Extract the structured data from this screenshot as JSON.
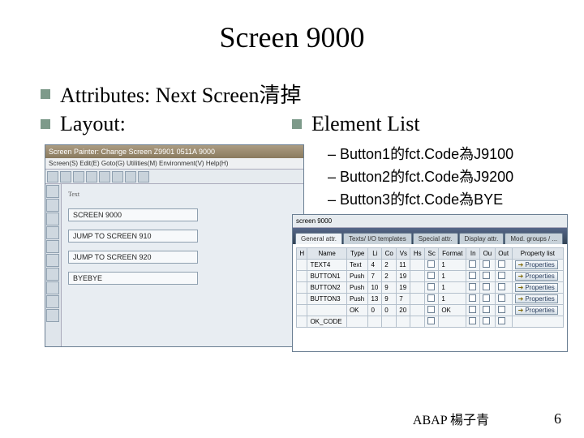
{
  "title": "Screen 9000",
  "bullets": {
    "b1": "Attributes: Next Screen清掉",
    "b2": "Layout:",
    "b3": "Element List"
  },
  "sublist": [
    "Button1的fct.Code為J9100",
    "Button2的fct.Code為J9200",
    "Button3的fct.Code為BYE"
  ],
  "shot1": {
    "titlebar": "Screen Painter: Change Screen Z9901 0511A 9000",
    "menu": "Screen(S)  Edit(E)  Goto(G)  Utilities(M)  Environment(V)  Help(H)",
    "canvas_label": "Text",
    "fields": [
      "SCREEN 9000",
      "JUMP TO SCREEN 910",
      "JUMP TO SCREEN 920",
      "BYEBYE"
    ]
  },
  "shot2": {
    "hdr": "screen                         9000",
    "tabs": [
      "General attr.",
      "Texts/ I/O templates",
      "Special attr.",
      "Display attr.",
      "Mod. groups / ..."
    ],
    "headers": [
      "H",
      "Name",
      "Type",
      "Li",
      "Co",
      "Vs",
      "Hs",
      "Sc",
      "Format",
      "In",
      "Ou",
      "Out",
      "Property list"
    ],
    "rows": [
      {
        "name": "TEXT4",
        "type": "Text",
        "li": "4",
        "co": "2",
        "vs": "11",
        "hs": "",
        "sc": "",
        "fmt": "1",
        "in": "",
        "ou": "",
        "out": "",
        "plist": "Properties"
      },
      {
        "name": "BUTTON1",
        "type": "Push",
        "li": "7",
        "co": "2",
        "vs": "19",
        "hs": "",
        "sc": "",
        "fmt": "1",
        "in": "",
        "ou": "",
        "out": "",
        "plist": "Properties"
      },
      {
        "name": "BUTTON2",
        "type": "Push",
        "li": "10",
        "co": "9",
        "vs": "19",
        "hs": "",
        "sc": "",
        "fmt": "1",
        "in": "",
        "ou": "",
        "out": "",
        "plist": "Properties"
      },
      {
        "name": "BUTTON3",
        "type": "Push",
        "li": "13",
        "co": "9",
        "vs": "7",
        "hs": "",
        "sc": "",
        "fmt": "1",
        "in": "",
        "ou": "",
        "out": "",
        "plist": "Properties"
      },
      {
        "name": "",
        "type": "OK",
        "li": "0",
        "co": "0",
        "vs": "20",
        "hs": "",
        "sc": "",
        "fmt": "OK",
        "in": "",
        "ou": "",
        "out": "",
        "plist": "Properties"
      },
      {
        "name": "OK_CODE",
        "type": "",
        "li": "",
        "co": "",
        "vs": "",
        "hs": "",
        "sc": "",
        "fmt": "",
        "in": "",
        "ou": "",
        "out": "",
        "plist": ""
      }
    ]
  },
  "footer": {
    "author": "ABAP 楊子青",
    "page": "6"
  }
}
